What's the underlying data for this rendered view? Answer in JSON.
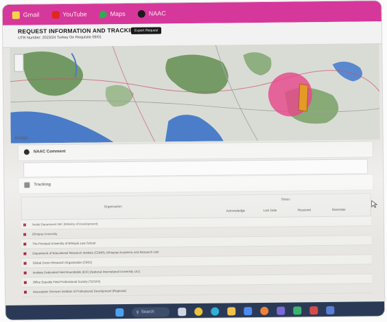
{
  "bookmarks": [
    {
      "label": "Gmail",
      "icon": "gmail-icon",
      "color": "#f4d34a"
    },
    {
      "label": "YouTube",
      "icon": "youtube-icon",
      "color": "#e1261c"
    },
    {
      "label": "Maps",
      "icon": "maps-icon",
      "color": "#34a853"
    },
    {
      "label": "NAAC",
      "icon": "naac-icon",
      "color": "#1b1b1b"
    }
  ],
  "header": {
    "title": "REQUEST INFORMATION AND TRACKING",
    "subtitle": "UTR Number: 2023/24 Turkey On Requisite 09/01",
    "button_label": "Export Request"
  },
  "map": {
    "logo": "Google",
    "accent_circle": "#e7488b",
    "accent_polygon": "#e59a26"
  },
  "comment_section": {
    "title": "NAAC Comment"
  },
  "tracking_section": {
    "title": "Tracking"
  },
  "table": {
    "group_header": "Status",
    "columns": [
      "Organisation",
      "Acknowledge",
      "Last Date",
      "Received",
      "Reminder"
    ],
    "rows": [
      "Nodal Department NIC (Ministry of Development)",
      "Ethiopia University",
      "The Principal University of Ethiopia Law School",
      "Department of Educational Research Institute (CDNR), Ethiopian Academic and Research Unit",
      "Global Green Research Organisation (GRO)",
      "Institute Dedicated Field Roundtable (IDF) (National International University Ltd.)",
      "Office Equality Field Professional Society (TESAS)",
      "Association Services Institute of Professional Development (Regional)"
    ]
  },
  "taskbar": {
    "search_label": "Search",
    "apps": [
      {
        "icon": "windows-start-icon",
        "color": "#4aa3f0"
      },
      {
        "icon": "task-view-icon",
        "color": "#cfd6e4"
      },
      {
        "icon": "chrome-icon",
        "color": "#e8c23a"
      },
      {
        "icon": "edge-icon",
        "color": "#2fb0d8"
      },
      {
        "icon": "file-explorer-icon",
        "color": "#f2c24a"
      },
      {
        "icon": "app-icon",
        "color": "#4d8bf2"
      },
      {
        "icon": "firefox-icon",
        "color": "#f0803a"
      },
      {
        "icon": "app-icon-2",
        "color": "#7a6ad6"
      },
      {
        "icon": "app-icon-3",
        "color": "#3cb371"
      },
      {
        "icon": "app-icon-4",
        "color": "#d84b4b"
      },
      {
        "icon": "app-icon-5",
        "color": "#5c7fd6"
      }
    ]
  }
}
